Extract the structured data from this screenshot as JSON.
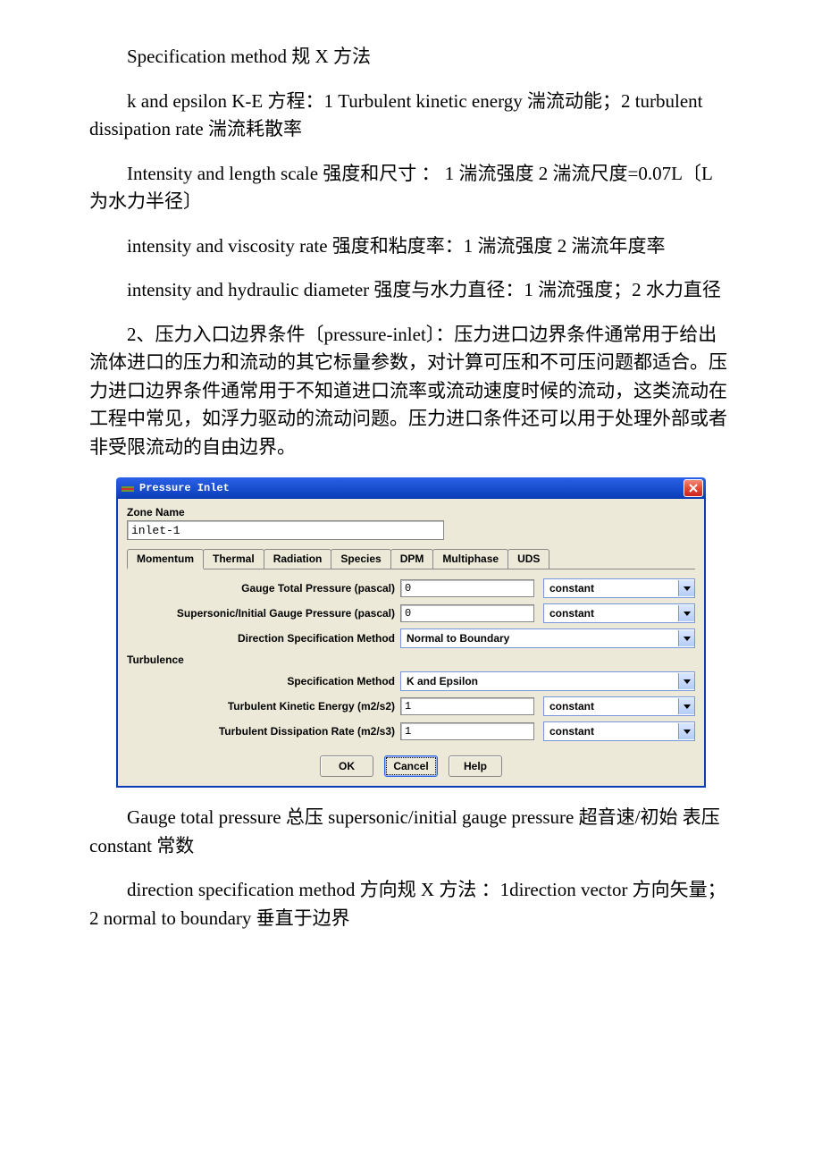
{
  "paragraphs": {
    "p1": "Specification method 规 X 方法",
    "p2": " k and epsilon K-E 方程：1 Turbulent kinetic energy 湍流动能；2 turbulent dissipation rate 湍流耗散率",
    "p3": "Intensity and length scale 强度和尺寸 ： 1 湍流强度 2 湍流尺度=0.07L〔L 为水力半径〕",
    "p4": "intensity and viscosity rate 强度和粘度率：1 湍流强度 2 湍流年度率",
    "p5": "intensity and hydraulic diameter 强度与水力直径：1 湍流强度；2 水力直径",
    "p6": "2、压力入口边界条件〔pressure-inlet〕：压力进口边界条件通常用于给出流体进口的压力和流动的其它标量参数，对计算可压和不可压问题都适合。压力进口边界条件通常用于不知道进口流率或流动速度时候的流动，这类流动在工程中常见，如浮力驱动的流动问题。压力进口条件还可以用于处理外部或者非受限流动的自由边界。",
    "p7": "Gauge total pressure 总压 supersonic/initial gauge pressure 超音速/初始 表压 constant 常数",
    "p8": " direction specification method 方向规 X 方法 ：1direction vector 方向矢量；2 normal to boundary 垂直于边界"
  },
  "dialog": {
    "title": "Pressure Inlet",
    "zone_label": "Zone Name",
    "zone_value": "inlet-1",
    "tabs": [
      "Momentum",
      "Thermal",
      "Radiation",
      "Species",
      "DPM",
      "Multiphase",
      "UDS"
    ],
    "rows": {
      "gtp_label": "Gauge Total Pressure (pascal)",
      "gtp_value": "0",
      "gtp_const": "constant",
      "sig_label": "Supersonic/Initial Gauge Pressure (pascal)",
      "sig_value": "0",
      "sig_const": "constant",
      "dsm_label": "Direction Specification Method",
      "dsm_value": "Normal to Boundary",
      "turb_section": "Turbulence",
      "spec_label": "Specification Method",
      "spec_value": "K and Epsilon",
      "tke_label": "Turbulent Kinetic Energy (m2/s2)",
      "tke_value": "1",
      "tke_const": "constant",
      "tdr_label": "Turbulent Dissipation Rate (m2/s3)",
      "tdr_value": "1",
      "tdr_const": "constant"
    },
    "buttons": {
      "ok": "OK",
      "cancel": "Cancel",
      "help": "Help"
    }
  }
}
